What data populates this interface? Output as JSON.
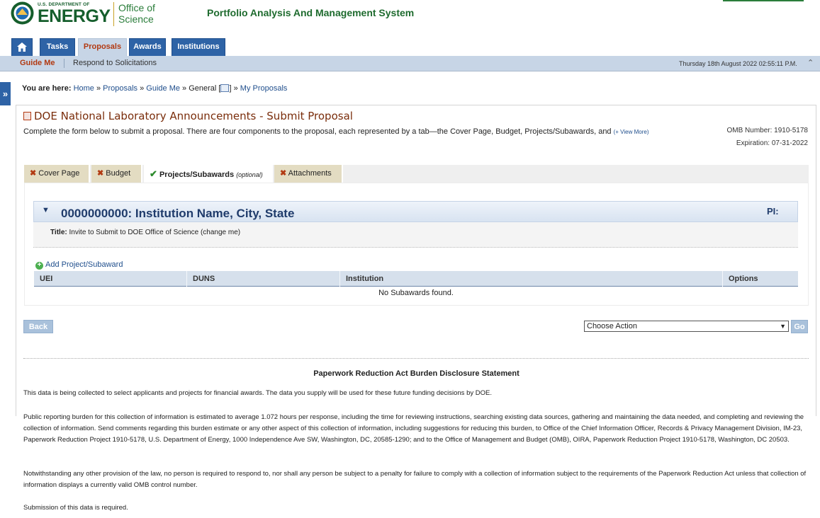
{
  "header": {
    "doe_small": "U.S. DEPARTMENT OF",
    "doe_big": "ENERGY",
    "office_line1": "Office of",
    "office_line2": "Science",
    "app_title": "Portfolio Analysis And Management System"
  },
  "main_tabs": [
    {
      "label": "Tasks"
    },
    {
      "label": "Proposals"
    },
    {
      "label": "Awards"
    },
    {
      "label": "Institutions"
    }
  ],
  "subnav": {
    "guide": "Guide Me",
    "respond": "Respond to Solicitations",
    "datetime": "Thursday 18th August 2022 02:55:11 P.M.",
    "collapse_icon": "double-chevron-up-icon"
  },
  "expander_icon": "double-chevron-right-icon",
  "breadcrumb": {
    "prefix": "You are here:",
    "home": "Home",
    "proposals": "Proposals",
    "guide": "Guide Me",
    "general": "General [",
    "general_close": "]",
    "my_proposals": "My Proposals"
  },
  "page": {
    "title": "DOE National Laboratory Announcements - Submit Proposal",
    "description": "Complete the form below to submit a proposal. There are four components to the proposal, each represented by a tab—the Cover Page, Budget, Projects/Subawards, and",
    "view_more": "(+ View More)",
    "omb_number": "OMB Number: 1910-5178",
    "expiration": "Expiration: 07-31-2022"
  },
  "form_tabs": [
    {
      "label": "Cover Page",
      "status_icon": "x-icon"
    },
    {
      "label": "Budget",
      "status_icon": "x-icon"
    },
    {
      "label": "Projects/Subawards",
      "optional": "(optional)",
      "status_icon": "check-icon"
    },
    {
      "label": "Attachments",
      "status_icon": "x-icon"
    }
  ],
  "institution": {
    "name": "0000000000:  Institution Name, City, State",
    "pi_label": "PI:",
    "title_label": "Title:",
    "title_value": "Invite to Submit to DOE Office of Science (change me)"
  },
  "subawards": {
    "add_label": "Add Project/Subaward",
    "columns": [
      "UEI",
      "DUNS",
      "Institution",
      "Options"
    ],
    "empty_message": "No Subawards found."
  },
  "actions": {
    "back": "Back",
    "choose_action": "Choose Action",
    "go": "Go"
  },
  "disclosure": {
    "title": "Paperwork Reduction Act Burden Disclosure Statement",
    "p1": "This data is being collected to select applicants and projects for financial awards. The data you supply will be used for these future funding decisions by DOE.",
    "p2": "Public reporting burden for this collection of information is estimated to average 1.072 hours per response, including the time for reviewing instructions, searching existing data sources, gathering and maintaining the data needed, and completing and reviewing the collection of information. Send comments regarding this burden estimate or any other aspect of this collection of information, including suggestions for reducing this burden, to Office of the Chief Information Officer, Records & Privacy Management Division, IM-23, Paperwork Reduction Project 1910-5178, U.S. Department of Energy, 1000 Independence Ave SW, Washington, DC, 20585-1290; and to the Office of Management and Budget (OMB), OIRA, Paperwork Reduction Project 1910-5178, Washington, DC 20503.",
    "p3": "Notwithstanding any other provision of the law, no person is required to respond to, nor shall any person be subject to a penalty for failure to comply with a collection of information subject to the requirements of the Paperwork Reduction Act unless that collection of information displays a currently valid OMB control number.",
    "p4": "Submission of this data is required."
  },
  "colors": {
    "brand_green": "#155e2c",
    "tab_blue": "#2e63a6",
    "accent_orange": "#b23a12",
    "title_brown": "#7a2d0b"
  }
}
